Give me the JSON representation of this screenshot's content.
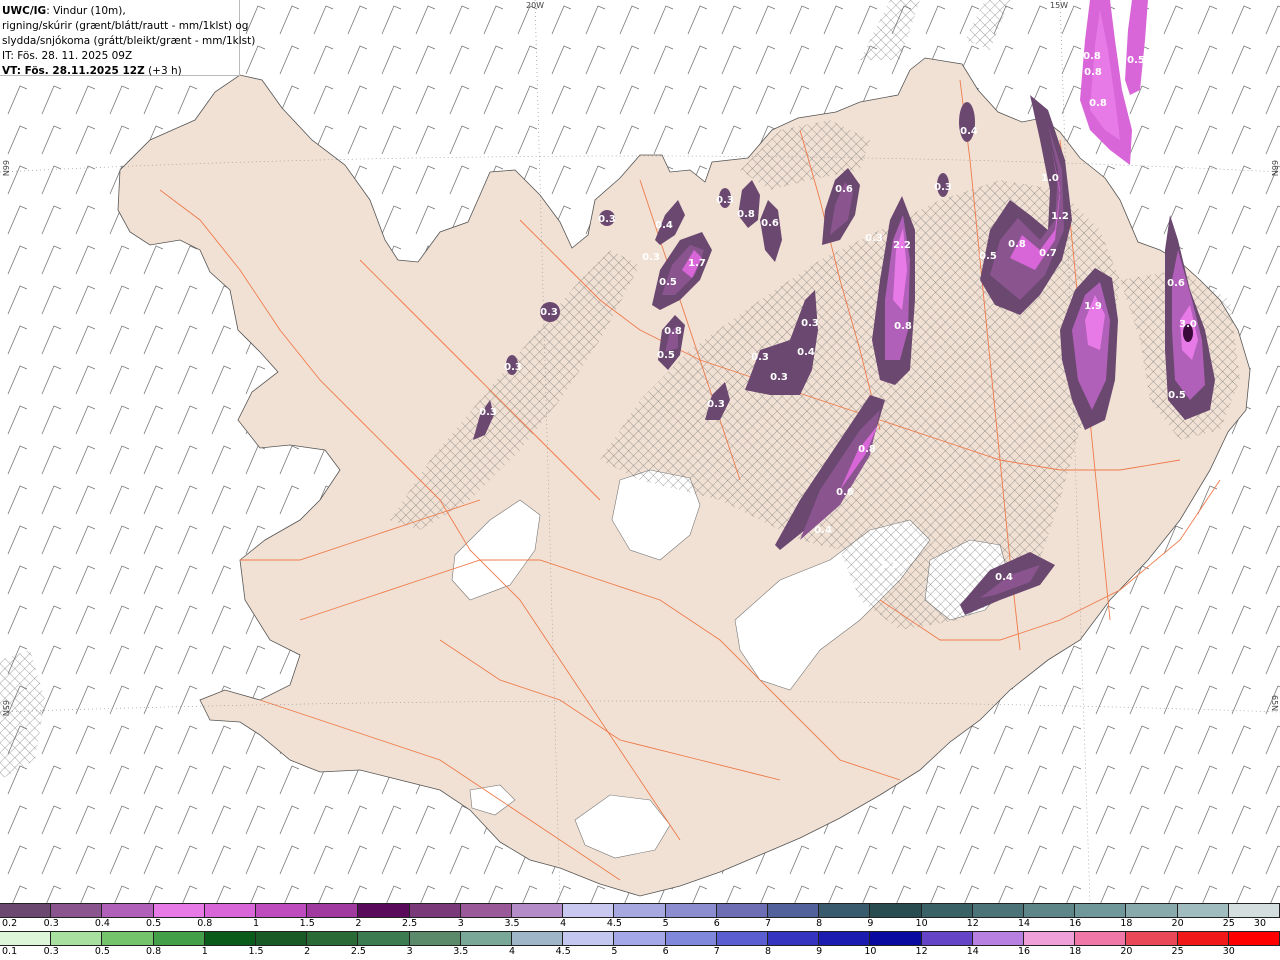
{
  "title": {
    "model": "UWC/IG",
    "desc1": ": Vindur (10m),",
    "desc2": "rigning/skúrir (grænt/blátt/rautt - mm/1klst) og",
    "desc3": "slydda/snjókoma (grátt/bleikt/grænt - mm/1klst)",
    "it": "IT: Fös. 28. 11. 2025 09Z",
    "vt_bold": "VT: Fös. 28.11.2025 12Z",
    "vt_rest": " (+3 h)"
  },
  "graticule": {
    "meridian_20w": "20W",
    "meridian_15w": "15W",
    "lat_66n": "66N",
    "lat_65n": "65N"
  },
  "precip_labels": [
    "0.3",
    "0.4",
    "0.3",
    "1.7",
    "0.5",
    "0.8",
    "0.6",
    "0.6",
    "0.3",
    "2.2",
    "0.8",
    "0.3",
    "0.3",
    "0.8",
    "0.5",
    "0.3",
    "0.4",
    "0.3",
    "0.3",
    "0.3",
    "0.3",
    "0.3",
    "0.4",
    "0.3",
    "1.0",
    "1.2",
    "0.8",
    "0.7",
    "0.5",
    "1.9",
    "0.6",
    "3.0",
    "0.5",
    "0.8",
    "0.8",
    "0.8",
    "0.5",
    "0.8",
    "0.6",
    "0.4",
    "0.4",
    "0.3"
  ],
  "legend_snow": {
    "ticks": [
      "0.2",
      "0.3",
      "0.4",
      "0.5",
      "0.8",
      "1",
      "1.5",
      "2",
      "2.5",
      "3",
      "3.5",
      "4",
      "4.5",
      "5",
      "6",
      "7",
      "8",
      "9",
      "10",
      "12",
      "14",
      "16",
      "18",
      "20",
      "25",
      "30"
    ],
    "colors": [
      "#6b4870",
      "#8a548f",
      "#b060b8",
      "#e87ae8",
      "#d866d8",
      "#bf4cbf",
      "#a03aa0",
      "#5a0a5a",
      "#7a3a7a",
      "#9a5a9a",
      "#b48cc8",
      "#c8c8f0",
      "#a8a8e0",
      "#8c8cd0",
      "#6e6eb4",
      "#52609c",
      "#3a5a6e",
      "#284c50",
      "#3a6266",
      "#4c7478",
      "#5e8688",
      "#70989a",
      "#88aaac",
      "#a0bcbe",
      "#d4dede"
    ]
  },
  "legend_rain": {
    "ticks": [
      "0.1",
      "0.3",
      "0.5",
      "0.8",
      "1",
      "1.5",
      "2",
      "2.5",
      "3",
      "3.5",
      "4",
      "4.5",
      "5",
      "6",
      "7",
      "8",
      "9",
      "10",
      "12",
      "14",
      "16",
      "18",
      "20",
      "25",
      "30"
    ],
    "colors": [
      "#ddf5d8",
      "#a8e0a0",
      "#74c46c",
      "#44a048",
      "#0a5a1a",
      "#1a5a26",
      "#2a6a36",
      "#3c7a50",
      "#5a8a6a",
      "#7aa898",
      "#9eb6c8",
      "#c4c8f0",
      "#a4a8e8",
      "#8088dc",
      "#5a5ed0",
      "#3434c0",
      "#1c1cb0",
      "#0a0aa0",
      "#6644c8",
      "#b880e0",
      "#f0a0d8",
      "#f078a8",
      "#e84858",
      "#f01818",
      "#ff0000"
    ]
  }
}
